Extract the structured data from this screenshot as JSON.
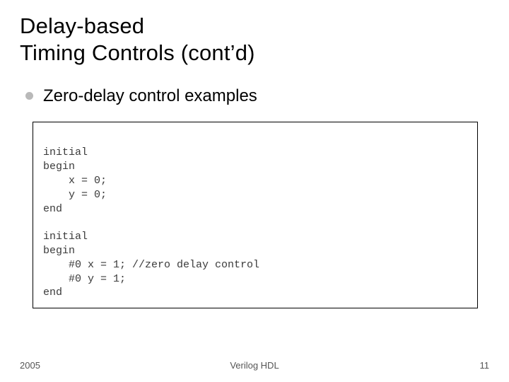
{
  "title_line1": "Delay-based",
  "title_line2": "Timing Controls (cont’d)",
  "bullet": "Zero-delay control examples",
  "code": {
    "l1": "initial",
    "l2": "begin",
    "l3": "    x = 0;",
    "l4": "    y = 0;",
    "l5": "end",
    "l6": "initial",
    "l7": "begin",
    "l8": "    #0 x = 1; //zero delay control",
    "l9": "    #0 y = 1;",
    "l10": "end"
  },
  "footer": {
    "left": "2005",
    "center": "Verilog HDL",
    "right": "11"
  }
}
